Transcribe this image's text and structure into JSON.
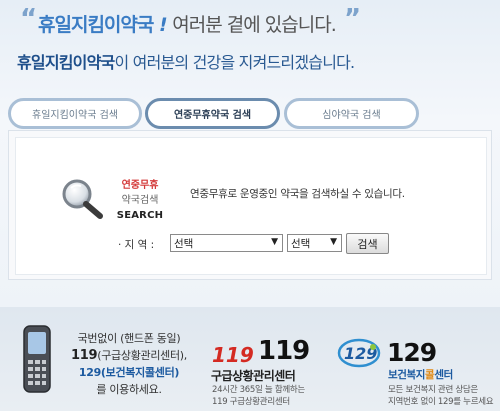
{
  "header": {
    "quote_open": "“",
    "slogan_brand": "휴일지킴이약국",
    "slogan_excl": "!",
    "slogan_rest": "여러분 곁에 있습니다.",
    "quote_close": "”",
    "subline_brand": "휴일지킴이약국",
    "subline_rest": "이 여러분의 건강을 지켜드리겠습니다."
  },
  "tabs": [
    {
      "label": "휴일지킴이약국 검색",
      "active": false
    },
    {
      "label": "연중무휴약국 검색",
      "active": true
    },
    {
      "label": "심야약국 검색",
      "active": false
    }
  ],
  "search_panel": {
    "label_line1": "연중무휴",
    "label_line2": "약국검색",
    "label_line3": "SEARCH",
    "description": "연중무휴로 운영중인 약국을 검색하실 수 있습니다.",
    "region_label": "· 지 역 :",
    "select_1": "선택",
    "select_2": "선택",
    "search_button": "검색"
  },
  "footer": {
    "phone_line1": "국번없이 (핸드폰 동일)",
    "phone_num_119": "119",
    "phone_119_desc": "(구급상황관리센터),",
    "phone_num_129": "129",
    "phone_129_desc": "(보건복지콜센터)",
    "phone_line4": "를 이용하세요.",
    "center_119_logo": "119",
    "center_119_num": "119",
    "center_119_title": "구급상황관리센터",
    "center_119_desc1": "24시간 365일 늘 함께하는",
    "center_119_desc2": "119 구급상황관리센터",
    "center_129_logo": "129",
    "center_129_num": "129",
    "center_129_title_a": "보건복지",
    "center_129_title_b": "콜",
    "center_129_title_c": "센터",
    "center_129_desc1": "모든 보건복지 관련 상담은",
    "center_129_desc2": "지역번호 없이 129를 누르세요"
  },
  "colors": {
    "accent_blue": "#3a7cc4",
    "dark_blue": "#1e4f8b",
    "red": "#d43a3a",
    "orange": "#e08a16"
  }
}
